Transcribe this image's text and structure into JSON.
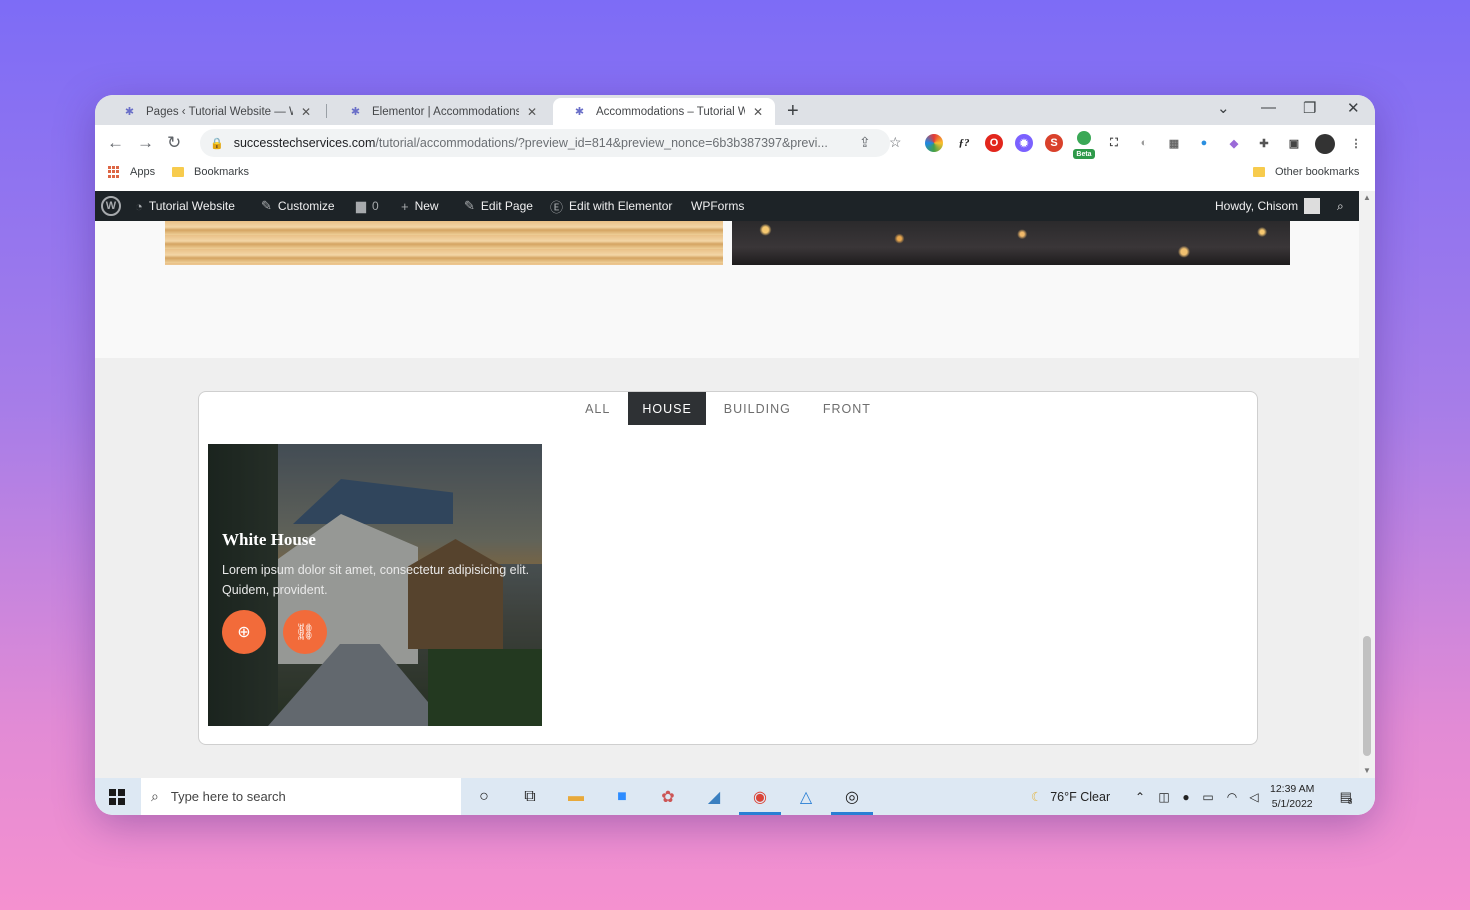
{
  "browser": {
    "tabs": [
      {
        "title": "Pages ‹ Tutorial Website — Word",
        "close": "✕"
      },
      {
        "title": "Elementor | Accommodations",
        "close": "✕"
      },
      {
        "title": "Accommodations – Tutorial Web",
        "close": "✕"
      }
    ],
    "new_tab": "+",
    "window_controls": {
      "dropdown": "⌄",
      "minimize": "—",
      "restore": "❐",
      "close": "✕"
    },
    "url_host": "successtechservices.com",
    "url_path": "/tutorial/accommodations/?preview_id=814&preview_nonce=6b3b387397&previ...",
    "extension_beta_label": "Beta",
    "bookmarks": {
      "apps": "Apps",
      "bookmarks": "Bookmarks",
      "other": "Other bookmarks"
    }
  },
  "wp_admin_bar": {
    "site_name": "Tutorial Website",
    "customize": "Customize",
    "comments_count": "0",
    "new": "New",
    "edit_page": "Edit Page",
    "edit_with_elementor": "Edit with Elementor",
    "wpforms": "WPForms",
    "howdy": "Howdy, Chisom"
  },
  "gallery": {
    "filters": [
      {
        "label": "ALL",
        "active": false
      },
      {
        "label": "HOUSE",
        "active": true
      },
      {
        "label": "BUILDING",
        "active": false
      },
      {
        "label": "FRONT",
        "active": false
      }
    ],
    "card": {
      "title": "White House",
      "text": "Lorem ipsum dolor sit amet, consectetur adipisicing elit. Quidem, provident."
    }
  },
  "taskbar": {
    "search_placeholder": "Type here to search",
    "weather": "76°F  Clear",
    "time": "12:39 AM",
    "date": "5/1/2022",
    "notification_count": "8"
  },
  "colors": {
    "accent_orange": "#f26b3a",
    "filter_active_bg": "#2e3134",
    "wp_bar": "#1d2327"
  }
}
